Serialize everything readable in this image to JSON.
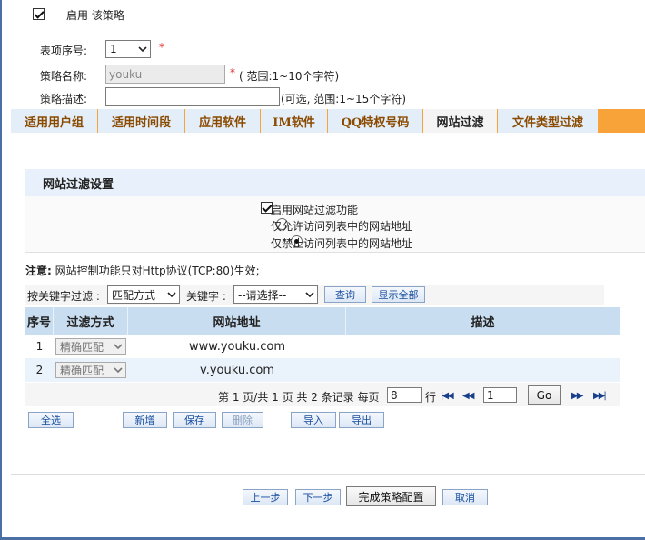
{
  "enable_policy": {
    "label": "启用 该策略",
    "checked": true
  },
  "form": {
    "index_label": "表项序号:",
    "index_value": "1",
    "index_required": "*",
    "name_label": "策略名称:",
    "name_value": "youku",
    "name_hint_star": "*",
    "name_hint": "( 范围:1~10个字符)",
    "desc_label": "策略描述:",
    "desc_value": "",
    "desc_hint": "(可选, 范围:1~15个字符)"
  },
  "tabs": [
    {
      "label": "适用用户组",
      "active": false
    },
    {
      "label": "适用时间段",
      "active": false
    },
    {
      "label": "应用软件",
      "active": false
    },
    {
      "label": "IM软件",
      "active": false
    },
    {
      "label": "QQ特权号码",
      "active": false
    },
    {
      "label": "网站过滤",
      "active": true
    },
    {
      "label": "文件类型过滤",
      "active": false
    }
  ],
  "section_title": "网站过滤设置",
  "options": {
    "enable_filter": {
      "label": "启用网站过滤功能",
      "checked": true
    },
    "allow_only": {
      "label": "仅允许访问列表中的网站地址",
      "checked": false
    },
    "deny_only": {
      "label": "仅禁止访问列表中的网站地址",
      "checked": true
    }
  },
  "note": {
    "prefix": "注意:",
    "text": " 网站控制功能只对Http协议(TCP:80)生效;"
  },
  "filter": {
    "label": "按关键字过滤 :",
    "match_select": "匹配方式",
    "keyword_label": "关键字 :",
    "keyword_select": "--请选择--",
    "query_button": "查询",
    "show_all_button": "显示全部"
  },
  "table": {
    "headers": [
      "序号",
      "过滤方式",
      "网站地址",
      "描述"
    ],
    "rows": [
      {
        "index": "1",
        "mode": "精确匹配",
        "url": "www.youku.com",
        "desc": ""
      },
      {
        "index": "2",
        "mode": "精确匹配",
        "url": "v.youku.com",
        "desc": ""
      }
    ]
  },
  "pager": {
    "summary": "第 1 页/共 1 页 共 2 条记录 每页",
    "per_page": "8",
    "rows_unit": "行",
    "page_input": "1",
    "go_button": "Go"
  },
  "actions": {
    "select_all": "全选",
    "add": "新增",
    "save": "保存",
    "delete": "删除",
    "import": "导入",
    "export": "导出"
  },
  "footer": {
    "prev": "上一步",
    "next": "下一步",
    "finish": "完成策略配置",
    "cancel": "取消"
  },
  "colors": {
    "tab_bar": "#f8a23a",
    "tab_bg": "#e4eef9",
    "table_header": "#c9ddf1",
    "section_header": "#e8f1fb",
    "frame": "#4a6fa5"
  }
}
